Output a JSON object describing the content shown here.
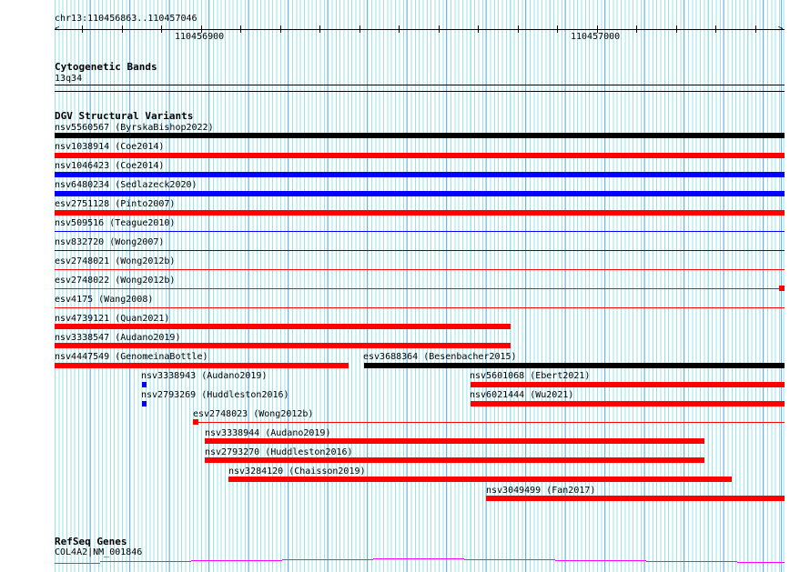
{
  "ruler": {
    "location": "chr13:110456863..110457046",
    "tick_labels": [
      "110456900",
      "110457000"
    ]
  },
  "tracks": {
    "cytogenetic": {
      "title": "Cytogenetic Bands",
      "band": "13q34"
    },
    "dgv": {
      "title": "DGV Structural Variants",
      "features": [
        {
          "id": "nsv5560567",
          "study": "ByrskaBishop2022",
          "color": "#000000"
        },
        {
          "id": "nsv1038914",
          "study": "Coe2014",
          "color": "#ff0000"
        },
        {
          "id": "nsv1046423",
          "study": "Coe2014",
          "color": "#0000ff"
        },
        {
          "id": "nsv6480234",
          "study": "Sedlazeck2020",
          "color": "#0000ff"
        },
        {
          "id": "esv2751128",
          "study": "Pinto2007",
          "color": "#ff0000"
        },
        {
          "id": "nsv509516",
          "study": "Teague2010",
          "color": "#0000ff"
        },
        {
          "id": "nsv832720",
          "study": "Wong2007",
          "color": "#0000ff"
        },
        {
          "id": "esv2748021",
          "study": "Wong2012b",
          "color": "#ff0000"
        },
        {
          "id": "esv2748022",
          "study": "Wong2012b",
          "color": "#ff0000"
        },
        {
          "id": "esv4175",
          "study": "Wang2008",
          "color": "#ff0000"
        },
        {
          "id": "nsv4739121",
          "study": "Quan2021",
          "color": "#ff0000"
        },
        {
          "id": "nsv3338547",
          "study": "Audano2019",
          "color": "#ff0000"
        },
        {
          "id": "nsv4447549",
          "study": "GenomeinaBottle",
          "color": "#ff0000"
        },
        {
          "id": "esv3688364",
          "study": "Besenbacher2015",
          "color": "#000000"
        },
        {
          "id": "nsv3338943",
          "study": "Audano2019",
          "color": "#0000ff"
        },
        {
          "id": "nsv5601068",
          "study": "Ebert2021",
          "color": "#ff0000"
        },
        {
          "id": "nsv2793269",
          "study": "Huddleston2016",
          "color": "#0000ff"
        },
        {
          "id": "nsv6021444",
          "study": "Wu2021",
          "color": "#ff0000"
        },
        {
          "id": "esv2748023",
          "study": "Wong2012b",
          "color": "#ff0000"
        },
        {
          "id": "nsv3338944",
          "study": "Audano2019",
          "color": "#ff0000"
        },
        {
          "id": "nsv2793270",
          "study": "Huddleston2016",
          "color": "#ff0000"
        },
        {
          "id": "nsv3284120",
          "study": "Chaisson2019",
          "color": "#ff0000"
        },
        {
          "id": "nsv3049499",
          "study": "Fan2017",
          "color": "#ff0000"
        }
      ]
    },
    "refseq": {
      "title": "RefSeq Genes",
      "gene": "COL4A2|NM_001846",
      "color": "#ff00ff"
    }
  }
}
